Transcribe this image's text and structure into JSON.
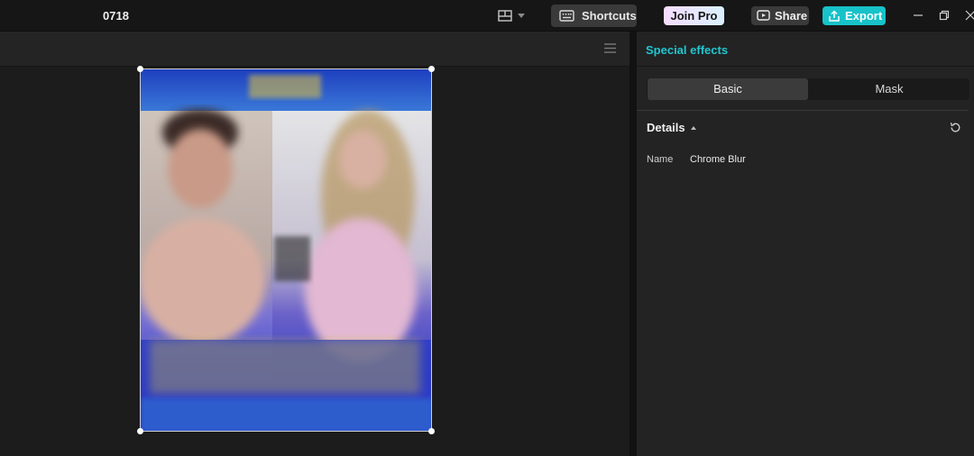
{
  "topbar": {
    "project_name": "0718",
    "shortcuts_label": "Shortcuts",
    "join_pro_label": "Join Pro",
    "share_label": "Share",
    "export_label": "Export"
  },
  "panel": {
    "title": "Special effects",
    "tabs": [
      {
        "label": "Basic",
        "active": true
      },
      {
        "label": "Mask",
        "active": false
      }
    ],
    "details_label": "Details",
    "name_label": "Name",
    "name_value": "Chrome Blur"
  },
  "colors": {
    "accent": "#1fc7d0",
    "export_bg": "#17c2c9",
    "background": "#1a1a1a",
    "panel": "#232323"
  },
  "icons": [
    "layout-icon",
    "keyboard-icon",
    "share-icon",
    "export-icon",
    "minimize-icon",
    "restore-icon",
    "close-icon",
    "menu-icon",
    "reset-icon"
  ]
}
